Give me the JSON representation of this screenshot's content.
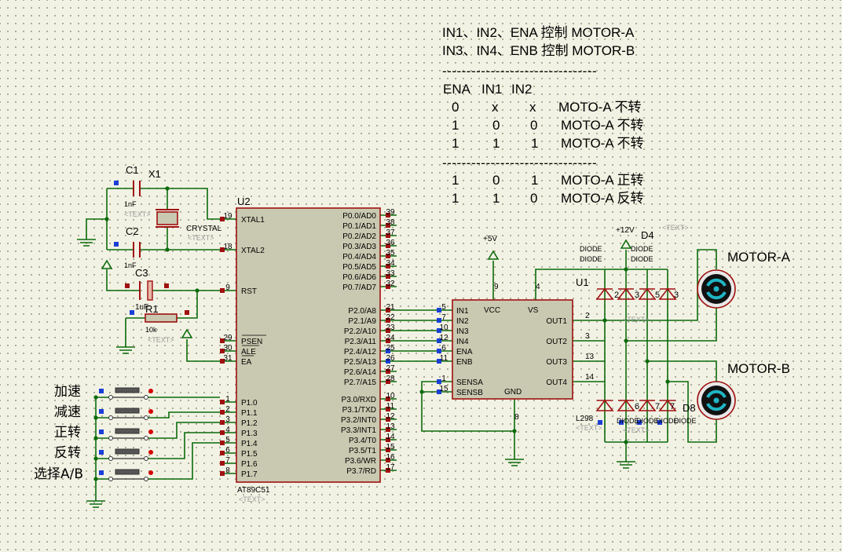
{
  "notes": {
    "line1": "IN1、IN2、ENA 控制 MOTOR-A",
    "line2": "IN3、IN4、ENB 控制 MOTOR-B",
    "sep": "--------------------------------",
    "header": [
      "ENA",
      "IN1",
      "IN2"
    ],
    "rows_off": [
      [
        "0",
        "x",
        "x",
        "MOTO-A 不转"
      ],
      [
        "1",
        "0",
        "0",
        "MOTO-A 不转"
      ],
      [
        "1",
        "1",
        "1",
        "MOTO-A 不转"
      ]
    ],
    "rows_on": [
      [
        "1",
        "0",
        "1",
        "MOTO-A 正转"
      ],
      [
        "1",
        "1",
        "0",
        "MOTO-A 反转"
      ]
    ]
  },
  "buttons": [
    "加速",
    "减速",
    "正转",
    "反转",
    "选择A/B"
  ],
  "motors": {
    "a": "MOTOR-A",
    "b": "MOTOR-B"
  },
  "mcu": {
    "ref": "U2",
    "part": "AT89C51",
    "text_ph": "<TEXT>",
    "left_pins": [
      {
        "num": "19",
        "name": "XTAL1"
      },
      {
        "num": "18",
        "name": "XTAL2"
      },
      {
        "num": "9",
        "name": "RST"
      },
      {
        "num": "29",
        "name": "PSEN"
      },
      {
        "num": "30",
        "name": "ALE"
      },
      {
        "num": "31",
        "name": "EA"
      },
      {
        "num": "1",
        "name": "P1.0"
      },
      {
        "num": "2",
        "name": "P1.1"
      },
      {
        "num": "3",
        "name": "P1.2"
      },
      {
        "num": "4",
        "name": "P1.3"
      },
      {
        "num": "5",
        "name": "P1.4"
      },
      {
        "num": "6",
        "name": "P1.5"
      },
      {
        "num": "7",
        "name": "P1.6"
      },
      {
        "num": "8",
        "name": "P1.7"
      }
    ],
    "right_pins": [
      {
        "num": "39",
        "name": "P0.0/AD0"
      },
      {
        "num": "38",
        "name": "P0.1/AD1"
      },
      {
        "num": "37",
        "name": "P0.2/AD2"
      },
      {
        "num": "36",
        "name": "P0.3/AD3"
      },
      {
        "num": "35",
        "name": "P0.4/AD4"
      },
      {
        "num": "34",
        "name": "P0.5/AD5"
      },
      {
        "num": "33",
        "name": "P0.6/AD6"
      },
      {
        "num": "32",
        "name": "P0.7/AD7"
      },
      {
        "num": "21",
        "name": "P2.0/A8"
      },
      {
        "num": "22",
        "name": "P2.1/A9"
      },
      {
        "num": "23",
        "name": "P2.2/A10"
      },
      {
        "num": "24",
        "name": "P2.3/A11"
      },
      {
        "num": "25",
        "name": "P2.4/A12"
      },
      {
        "num": "26",
        "name": "P2.5/A13"
      },
      {
        "num": "27",
        "name": "P2.6/A14"
      },
      {
        "num": "28",
        "name": "P2.7/A15"
      },
      {
        "num": "10",
        "name": "P3.0/RXD"
      },
      {
        "num": "11",
        "name": "P3.1/TXD"
      },
      {
        "num": "12",
        "name": "P3.2/INT0"
      },
      {
        "num": "13",
        "name": "P3.3/INT1"
      },
      {
        "num": "14",
        "name": "P3.4/T0"
      },
      {
        "num": "15",
        "name": "P3.5/T1"
      },
      {
        "num": "16",
        "name": "P3.6/WR"
      },
      {
        "num": "17",
        "name": "P3.7/RD"
      }
    ]
  },
  "driver": {
    "ref": "U1",
    "part": "L298",
    "text_ph": "<TEXT>",
    "left_pins": [
      {
        "num": "5",
        "name": "IN1"
      },
      {
        "num": "7",
        "name": "IN2"
      },
      {
        "num": "10",
        "name": "IN3"
      },
      {
        "num": "12",
        "name": "IN4"
      },
      {
        "num": "6",
        "name": "ENA"
      },
      {
        "num": "11",
        "name": "ENB"
      },
      {
        "num": "1",
        "name": "SENSA"
      },
      {
        "num": "15",
        "name": "SENSB"
      }
    ],
    "top_labels": {
      "vcc": "VCC",
      "vs": "VS",
      "gnd": "GND"
    },
    "top_pins": {
      "vcc": "9",
      "vs": "4",
      "gnd": "8"
    },
    "right_pins": [
      {
        "num": "2",
        "name": "OUT1"
      },
      {
        "num": "3",
        "name": "OUT2"
      },
      {
        "num": "13",
        "name": "OUT3"
      },
      {
        "num": "14",
        "name": "OUT4"
      }
    ]
  },
  "power": {
    "v5": "+5V",
    "v12": "+12V"
  },
  "parts": {
    "c1": {
      "ref": "C1",
      "val": "1nF",
      "text": "<TEXT>"
    },
    "c2": {
      "ref": "C2",
      "val": "1nF",
      "text": "<TEXT>"
    },
    "x1": {
      "ref": "X1",
      "val": "CRYSTAL",
      "text": "<TEXT>"
    },
    "c3": {
      "ref": "C3",
      "val": "1uF",
      "text": "<TEXT>"
    },
    "r1": {
      "ref": "R1",
      "val": "10k",
      "text": "<TEXT>"
    }
  },
  "diodes": {
    "d4": "D4",
    "d8": "D8",
    "top_val": "DIODE",
    "numbers": [
      "2",
      "3",
      "5",
      "6",
      "7"
    ],
    "text_ph": "<TEXT>"
  }
}
